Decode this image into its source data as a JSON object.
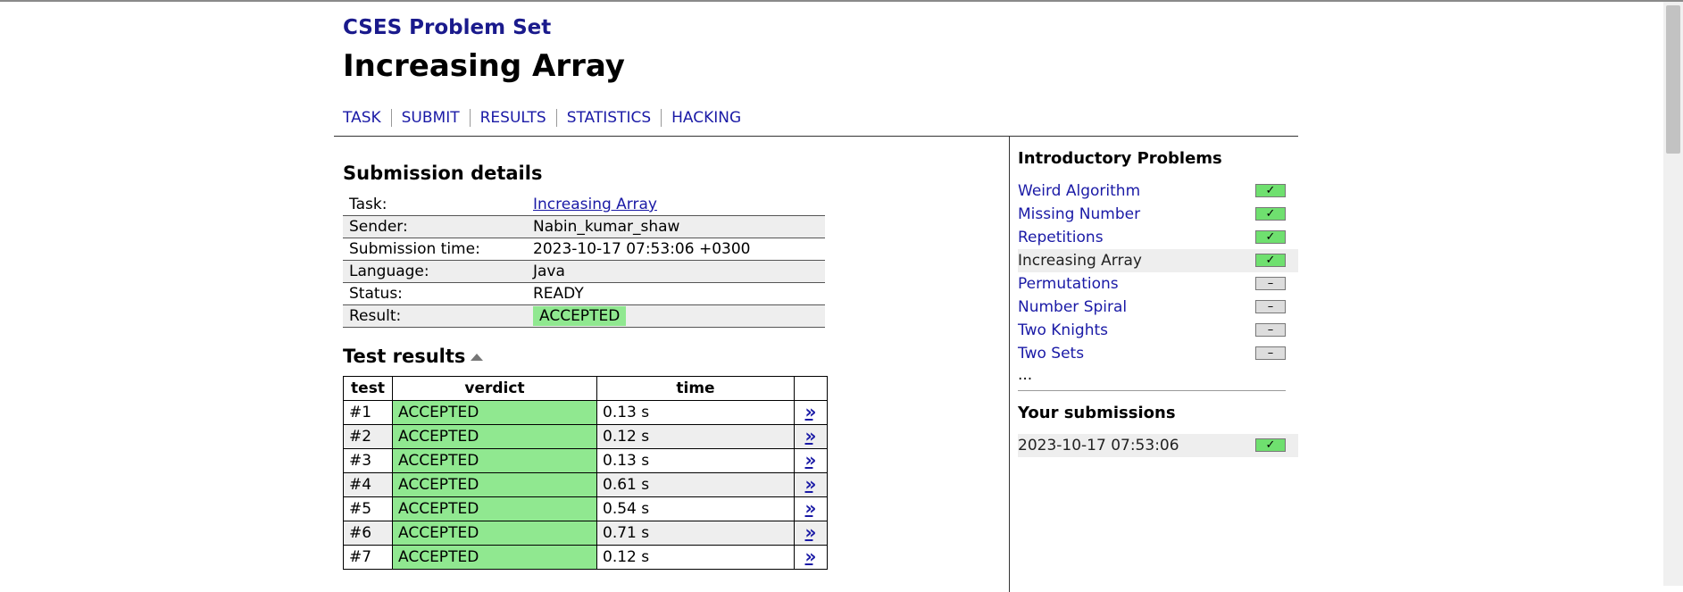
{
  "site_title": "CSES Problem Set",
  "page_title": "Increasing Array",
  "nav": [
    "TASK",
    "SUBMIT",
    "RESULTS",
    "STATISTICS",
    "HACKING"
  ],
  "submission": {
    "heading": "Submission details",
    "rows": [
      {
        "label": "Task:",
        "value": "Increasing Array"
      },
      {
        "label": "Sender:",
        "value": "Nabin_kumar_shaw"
      },
      {
        "label": "Submission time:",
        "value": "2023-10-17 07:53:06 +0300"
      },
      {
        "label": "Language:",
        "value": "Java"
      },
      {
        "label": "Status:",
        "value": "READY"
      },
      {
        "label": "Result:",
        "value": "ACCEPTED"
      }
    ]
  },
  "tests": {
    "heading": "Test results",
    "columns": [
      "test",
      "verdict",
      "time"
    ],
    "rows": [
      {
        "test": "#1",
        "verdict": "ACCEPTED",
        "time": "0.13 s"
      },
      {
        "test": "#2",
        "verdict": "ACCEPTED",
        "time": "0.12 s"
      },
      {
        "test": "#3",
        "verdict": "ACCEPTED",
        "time": "0.13 s"
      },
      {
        "test": "#4",
        "verdict": "ACCEPTED",
        "time": "0.61 s"
      },
      {
        "test": "#5",
        "verdict": "ACCEPTED",
        "time": "0.54 s"
      },
      {
        "test": "#6",
        "verdict": "ACCEPTED",
        "time": "0.71 s"
      },
      {
        "test": "#7",
        "verdict": "ACCEPTED",
        "time": "0.12 s"
      }
    ],
    "link_glyph": "»"
  },
  "sidebar": {
    "section_title": "Introductory Problems",
    "problems": [
      {
        "name": "Weird Algorithm",
        "status": "done",
        "mark": "✓"
      },
      {
        "name": "Missing Number",
        "status": "done",
        "mark": "✓"
      },
      {
        "name": "Repetitions",
        "status": "done",
        "mark": "✓"
      },
      {
        "name": "Increasing Array",
        "status": "done",
        "mark": "✓",
        "current": true
      },
      {
        "name": "Permutations",
        "status": "todo",
        "mark": "–"
      },
      {
        "name": "Number Spiral",
        "status": "todo",
        "mark": "–"
      },
      {
        "name": "Two Knights",
        "status": "todo",
        "mark": "–"
      },
      {
        "name": "Two Sets",
        "status": "todo",
        "mark": "–"
      }
    ],
    "more": "...",
    "submissions_title": "Your submissions",
    "submissions": [
      {
        "time": "2023-10-17 07:53:06",
        "status": "done",
        "mark": "✓"
      }
    ]
  },
  "colors": {
    "accepted": "#90e890",
    "done_box": "#6fe06f",
    "link": "#1a1aa6",
    "title": "#1a1a8c"
  }
}
